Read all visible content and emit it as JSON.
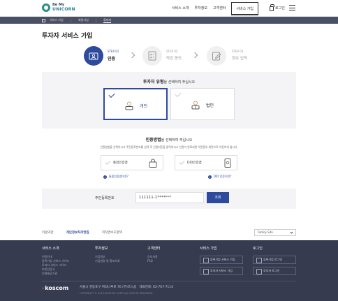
{
  "header": {
    "logo_top": "Be My",
    "logo_bottom": "UNICORN",
    "nav": [
      "서비스 소개",
      "투자정보",
      "고객센터",
      "서비스 가입"
    ],
    "login": "로그인"
  },
  "breadcrumb": [
    "서비스 가입",
    "회원가입",
    "투자자"
  ],
  "page_title": "투자자 서비스 가입",
  "steps": [
    {
      "label": "STEP 01",
      "name": "인증",
      "state": "active"
    },
    {
      "label": "STEP 02",
      "name": "약관 동의",
      "state": "inactive"
    },
    {
      "label": "STEP 03",
      "name": "정보 입력",
      "state": "inactive"
    }
  ],
  "investor_type": {
    "heading": "투자자 유형",
    "heading_suffix": "을 선택하여 주십시오",
    "options": [
      {
        "label": "개인",
        "selected": true
      },
      {
        "label": "법인",
        "selected": false
      }
    ]
  },
  "auth_method": {
    "heading": "인증방법",
    "heading_suffix": "을 선택하여 주십시오",
    "description": "인증방법을 선택하시고 주민등록번호를 입력 후 인증버튼을 클릭하시고 인증이 완료되면 약관동의 화면으로 이동하게 됩니다.",
    "options": [
      {
        "label": "통합인증앱"
      },
      {
        "label": "DID인증앱"
      }
    ],
    "help": [
      "통합인증앱이란?",
      "DID 인증이란?"
    ]
  },
  "rrn": {
    "label": "주민등록번호",
    "value": "111111-1*******",
    "button": "조회"
  },
  "footer_links": [
    "이용약관",
    "개인정보처리방침",
    "저작권보호정책"
  ],
  "family_site": "Family Site",
  "footer": {
    "cols": [
      {
        "title": "서비스 소개",
        "items": [
          "이용안내",
          "등록기업 서비스 가이드",
          "투자자 서비스 가이드",
          "보안인증서",
          "인재제공기관"
        ]
      },
      {
        "title": "투자정보",
        "items": [
          "기업정보",
          "기업설명 및 홍보자료"
        ]
      },
      {
        "title": "고객센터",
        "items": [
          "공지사항",
          "FAQ"
        ]
      },
      {
        "title": "서비스 가입",
        "buttons": [
          "등록기업 서비스 가입",
          "투자자 서비스 가입"
        ]
      },
      {
        "title": "로그인",
        "buttons": [
          "등록기업 로그인",
          "투자자 로그인"
        ]
      }
    ],
    "brand": "koscom",
    "address": "서울시 영등포구 여의나루로 76 (주)코스콤",
    "phone": "대표전화: 02-767-7114",
    "copyright": "COPYRIGHT © 2019 KOSCOM CORP. ALL RIGHTS RESERVED."
  }
}
